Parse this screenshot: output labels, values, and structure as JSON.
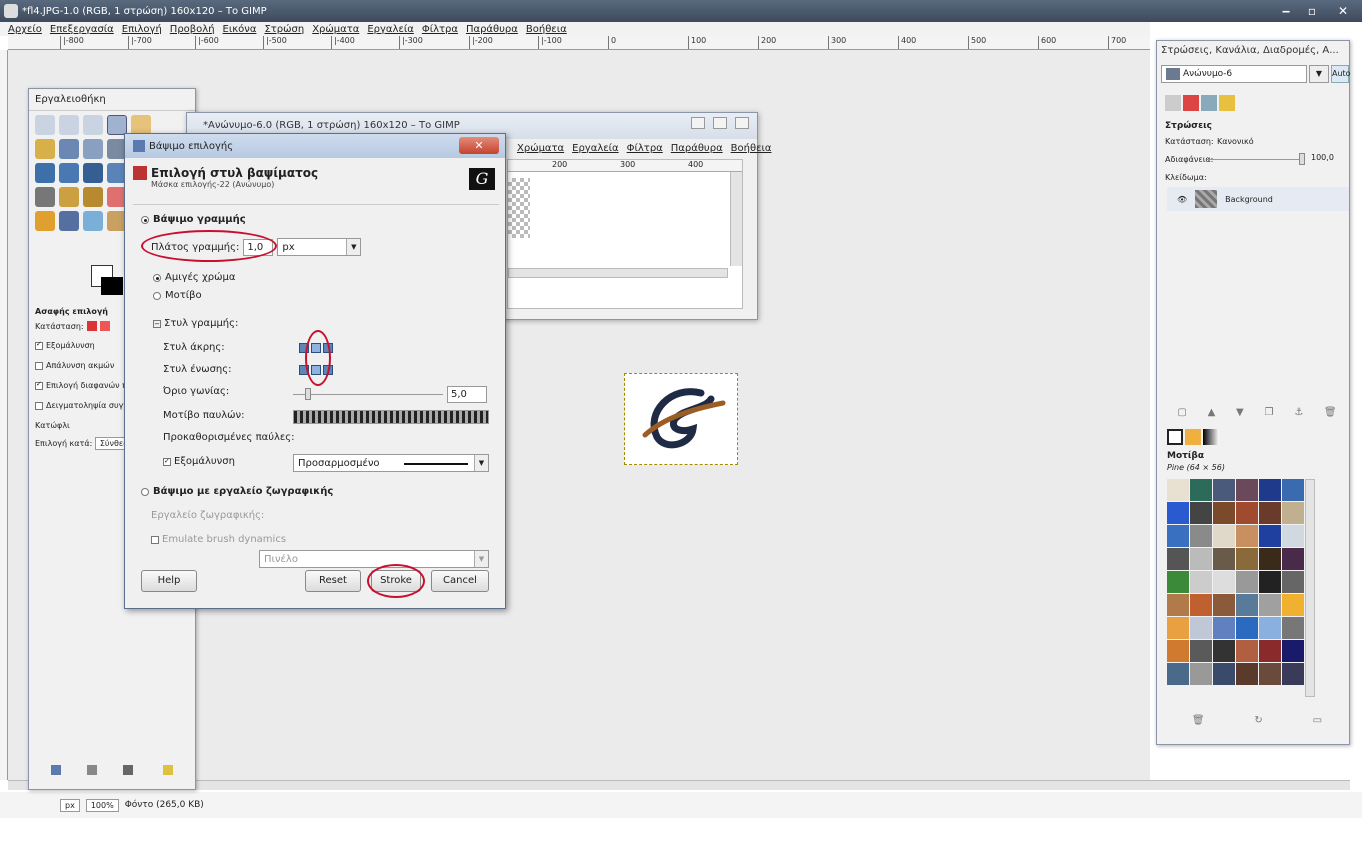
{
  "main": {
    "title": "*fl4.JPG-1.0 (RGB, 1 στρώση) 160x120 – Το GIMP",
    "controls": [
      "‒",
      "▫",
      "✕"
    ],
    "menus": [
      "Αρχείο",
      "Επεξεργασία",
      "Επιλογή",
      "Προβολή",
      "Εικόνα",
      "Στρώση",
      "Χρώματα",
      "Εργαλεία",
      "Φίλτρα",
      "Παράθυρα",
      "Βοήθεια"
    ],
    "ruler_ticks": [
      "|-800",
      "|-700",
      "|-600",
      "|-500",
      "|-400",
      "|-300",
      "|-200",
      "|-100",
      "0",
      "100",
      "200",
      "300",
      "400",
      "500",
      "600",
      "700"
    ],
    "status": {
      "unit": "px",
      "zoom": "100%",
      "info": "Φόντο (265,0 KB)"
    }
  },
  "toolbox": {
    "title": "Εργαλειοθήκη",
    "options_title": "Ασαφής επιλογή",
    "mode_label": "Κατάσταση:",
    "options": [
      {
        "label": "Εξομάλυνση",
        "checked": true
      },
      {
        "label": "Απάλυνση ακμών",
        "checked": false
      },
      {
        "label": "Επιλογή διαφανών π",
        "checked": true
      },
      {
        "label": "Δειγματοληψία συγχ",
        "checked": false
      }
    ],
    "threshold_label": "Κατώφλι",
    "select_by_label": "Επιλογή κατά:",
    "select_by_value": "Σύνθεση"
  },
  "image_window": {
    "title": "*Ανώνυμο-6.0 (RGB, 1 στρώση) 160x120 – Το GIMP",
    "menus": [
      "Χρώματα",
      "Εργαλεία",
      "Φίλτρα",
      "Παράθυρα",
      "Βοήθεια"
    ],
    "ruler": [
      "200",
      "300",
      "400"
    ]
  },
  "dialog": {
    "window_title": "Βάψιμο επιλογής",
    "header_title": "Επιλογή στυλ βαψίματος",
    "header_subtitle": "Μάσκα επιλογής-22 (Ανώνυμο)",
    "logo_glyph": "G",
    "stroke_line_label": "Βάψιμο γραμμής",
    "line_width_label": "Πλάτος γραμμής:",
    "line_width_value": "1,0",
    "line_width_unit": "px",
    "solid_color_label": "Αμιγές χρώμα",
    "pattern_label": "Μοτίβο",
    "line_style_label": "Στυλ γραμμής:",
    "cap_style_label": "Στυλ άκρης:",
    "join_style_label": "Στυλ ένωσης:",
    "miter_limit_label": "Όριο γωνίας:",
    "miter_limit_value": "5,0",
    "dash_pattern_label": "Μοτίβο παυλών:",
    "dash_preset_label": "Προκαθορισμένες παύλες:",
    "dash_preset_value": "Προσαρμοσμένο",
    "antialias_label": "Εξομάλυνση",
    "paint_tool_stroke_label": "Βάψιμο με εργαλείο ζωγραφικής",
    "paint_tool_label": "Εργαλείο ζωγραφικής:",
    "paint_tool_value": "Πινέλο",
    "emulate_label": "Emulate brush dynamics",
    "buttons": {
      "help": "Help",
      "reset": "Reset",
      "stroke": "Stroke",
      "cancel": "Cancel"
    }
  },
  "dock": {
    "title": "Στρώσεις, Κανάλια, Διαδρομές, Α...",
    "image_select": "Ανώνυμο-6",
    "auto_label": "Auto",
    "layers_title": "Στρώσεις",
    "mode_label": "Κατάσταση:",
    "mode_value": "Κανονικό",
    "opacity_label": "Αδιαφάνεια:",
    "opacity_value": "100,0",
    "lock_label": "Κλείδωμα:",
    "layer_name": "Background",
    "patterns_title": "Μοτίβα",
    "pattern_name": "Pine (64 × 56)"
  },
  "colors": {
    "accent_red": "#c8102e",
    "title_bar": "#3d4a5c"
  }
}
